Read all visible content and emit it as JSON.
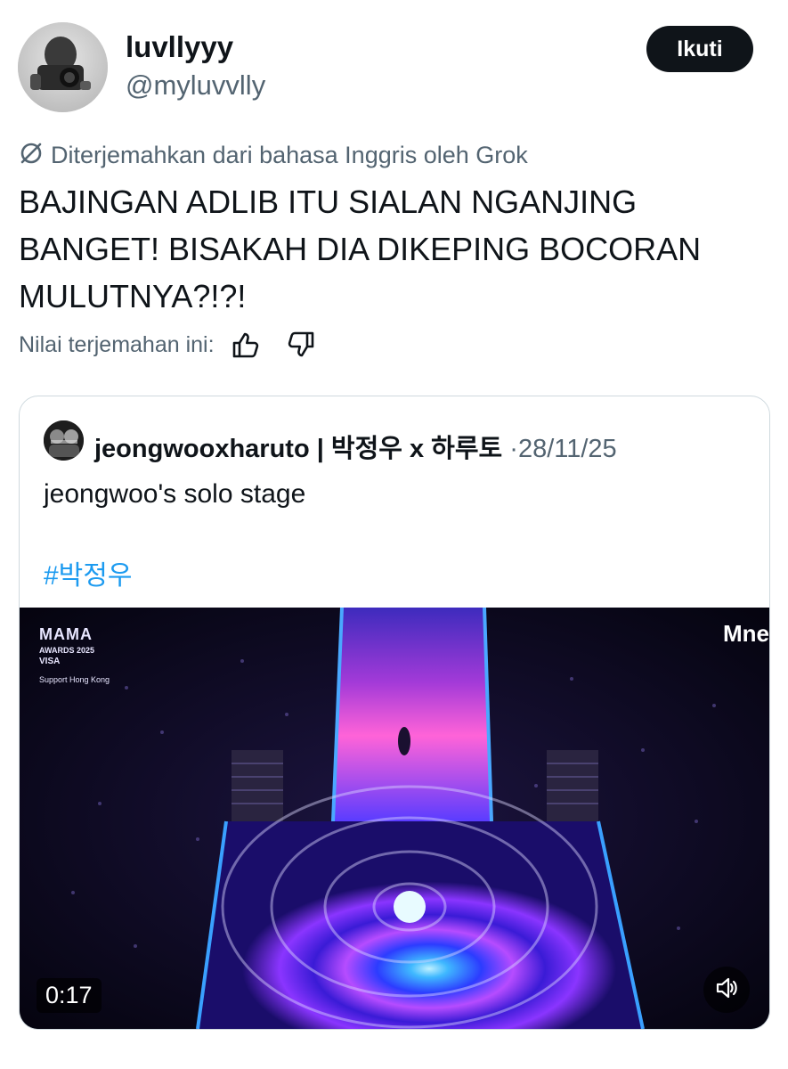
{
  "user": {
    "display_name": "luvllyyy",
    "handle": "@myluvvlly",
    "avatar_icon": "camera-portrait-avatar"
  },
  "follow_label": "Ikuti",
  "translation": {
    "notice": "Diterjemahkan dari bahasa Inggris oleh Grok",
    "icon": "translate-slash-icon"
  },
  "tweet_text": "BAJINGAN ADLIB ITU SIALAN NGANJING BANGET! BISAKAH DIA DIKEPING BOCORAN MULUTNYA?!?!",
  "rate": {
    "label": "Nilai terjemahan ini:",
    "icons": [
      "thumbs-up-icon",
      "thumbs-down-icon"
    ]
  },
  "quote": {
    "name": "jeongwooxharuto | 박정우 x 하루토",
    "separator": "·",
    "date": "28/11/25",
    "text": "jeongwoo's solo stage",
    "hashtag": "#박정우",
    "video": {
      "duration": "0:17",
      "overlay_logo_left": {
        "line1": "MAMA",
        "line2": "AWARDS 2025",
        "line3": "VISA",
        "line4": "Support Hong Kong"
      },
      "overlay_logo_right": "Mne",
      "mute_icon": "speaker-icon"
    }
  },
  "colors": {
    "text_primary": "#0f1419",
    "text_secondary": "#536471",
    "link": "#1d9bf0",
    "button_bg": "#0f1419",
    "border": "#cfd9de"
  }
}
